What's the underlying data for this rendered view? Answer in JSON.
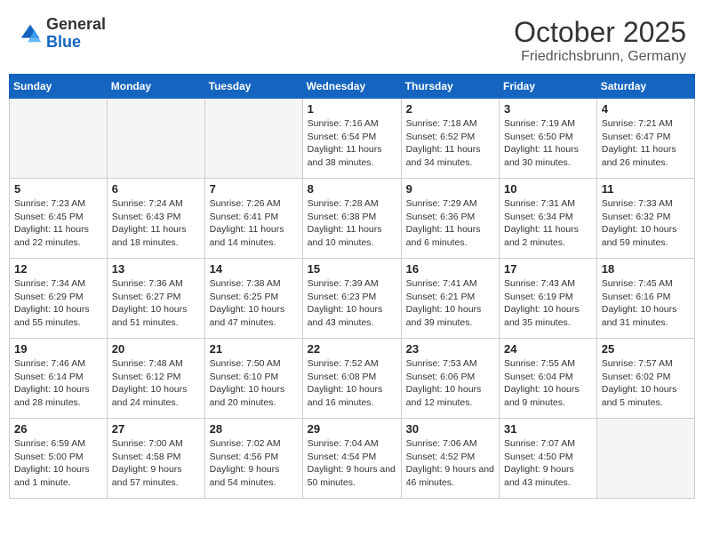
{
  "header": {
    "logo_general": "General",
    "logo_blue": "Blue",
    "month": "October 2025",
    "location": "Friedrichsbrunn, Germany"
  },
  "days_of_week": [
    "Sunday",
    "Monday",
    "Tuesday",
    "Wednesday",
    "Thursday",
    "Friday",
    "Saturday"
  ],
  "weeks": [
    [
      {
        "day": "",
        "info": ""
      },
      {
        "day": "",
        "info": ""
      },
      {
        "day": "",
        "info": ""
      },
      {
        "day": "1",
        "info": "Sunrise: 7:16 AM\nSunset: 6:54 PM\nDaylight: 11 hours and 38 minutes."
      },
      {
        "day": "2",
        "info": "Sunrise: 7:18 AM\nSunset: 6:52 PM\nDaylight: 11 hours and 34 minutes."
      },
      {
        "day": "3",
        "info": "Sunrise: 7:19 AM\nSunset: 6:50 PM\nDaylight: 11 hours and 30 minutes."
      },
      {
        "day": "4",
        "info": "Sunrise: 7:21 AM\nSunset: 6:47 PM\nDaylight: 11 hours and 26 minutes."
      }
    ],
    [
      {
        "day": "5",
        "info": "Sunrise: 7:23 AM\nSunset: 6:45 PM\nDaylight: 11 hours and 22 minutes."
      },
      {
        "day": "6",
        "info": "Sunrise: 7:24 AM\nSunset: 6:43 PM\nDaylight: 11 hours and 18 minutes."
      },
      {
        "day": "7",
        "info": "Sunrise: 7:26 AM\nSunset: 6:41 PM\nDaylight: 11 hours and 14 minutes."
      },
      {
        "day": "8",
        "info": "Sunrise: 7:28 AM\nSunset: 6:38 PM\nDaylight: 11 hours and 10 minutes."
      },
      {
        "day": "9",
        "info": "Sunrise: 7:29 AM\nSunset: 6:36 PM\nDaylight: 11 hours and 6 minutes."
      },
      {
        "day": "10",
        "info": "Sunrise: 7:31 AM\nSunset: 6:34 PM\nDaylight: 11 hours and 2 minutes."
      },
      {
        "day": "11",
        "info": "Sunrise: 7:33 AM\nSunset: 6:32 PM\nDaylight: 10 hours and 59 minutes."
      }
    ],
    [
      {
        "day": "12",
        "info": "Sunrise: 7:34 AM\nSunset: 6:29 PM\nDaylight: 10 hours and 55 minutes."
      },
      {
        "day": "13",
        "info": "Sunrise: 7:36 AM\nSunset: 6:27 PM\nDaylight: 10 hours and 51 minutes."
      },
      {
        "day": "14",
        "info": "Sunrise: 7:38 AM\nSunset: 6:25 PM\nDaylight: 10 hours and 47 minutes."
      },
      {
        "day": "15",
        "info": "Sunrise: 7:39 AM\nSunset: 6:23 PM\nDaylight: 10 hours and 43 minutes."
      },
      {
        "day": "16",
        "info": "Sunrise: 7:41 AM\nSunset: 6:21 PM\nDaylight: 10 hours and 39 minutes."
      },
      {
        "day": "17",
        "info": "Sunrise: 7:43 AM\nSunset: 6:19 PM\nDaylight: 10 hours and 35 minutes."
      },
      {
        "day": "18",
        "info": "Sunrise: 7:45 AM\nSunset: 6:16 PM\nDaylight: 10 hours and 31 minutes."
      }
    ],
    [
      {
        "day": "19",
        "info": "Sunrise: 7:46 AM\nSunset: 6:14 PM\nDaylight: 10 hours and 28 minutes."
      },
      {
        "day": "20",
        "info": "Sunrise: 7:48 AM\nSunset: 6:12 PM\nDaylight: 10 hours and 24 minutes."
      },
      {
        "day": "21",
        "info": "Sunrise: 7:50 AM\nSunset: 6:10 PM\nDaylight: 10 hours and 20 minutes."
      },
      {
        "day": "22",
        "info": "Sunrise: 7:52 AM\nSunset: 6:08 PM\nDaylight: 10 hours and 16 minutes."
      },
      {
        "day": "23",
        "info": "Sunrise: 7:53 AM\nSunset: 6:06 PM\nDaylight: 10 hours and 12 minutes."
      },
      {
        "day": "24",
        "info": "Sunrise: 7:55 AM\nSunset: 6:04 PM\nDaylight: 10 hours and 9 minutes."
      },
      {
        "day": "25",
        "info": "Sunrise: 7:57 AM\nSunset: 6:02 PM\nDaylight: 10 hours and 5 minutes."
      }
    ],
    [
      {
        "day": "26",
        "info": "Sunrise: 6:59 AM\nSunset: 5:00 PM\nDaylight: 10 hours and 1 minute."
      },
      {
        "day": "27",
        "info": "Sunrise: 7:00 AM\nSunset: 4:58 PM\nDaylight: 9 hours and 57 minutes."
      },
      {
        "day": "28",
        "info": "Sunrise: 7:02 AM\nSunset: 4:56 PM\nDaylight: 9 hours and 54 minutes."
      },
      {
        "day": "29",
        "info": "Sunrise: 7:04 AM\nSunset: 4:54 PM\nDaylight: 9 hours and 50 minutes."
      },
      {
        "day": "30",
        "info": "Sunrise: 7:06 AM\nSunset: 4:52 PM\nDaylight: 9 hours and 46 minutes."
      },
      {
        "day": "31",
        "info": "Sunrise: 7:07 AM\nSunset: 4:50 PM\nDaylight: 9 hours and 43 minutes."
      },
      {
        "day": "",
        "info": ""
      }
    ]
  ]
}
